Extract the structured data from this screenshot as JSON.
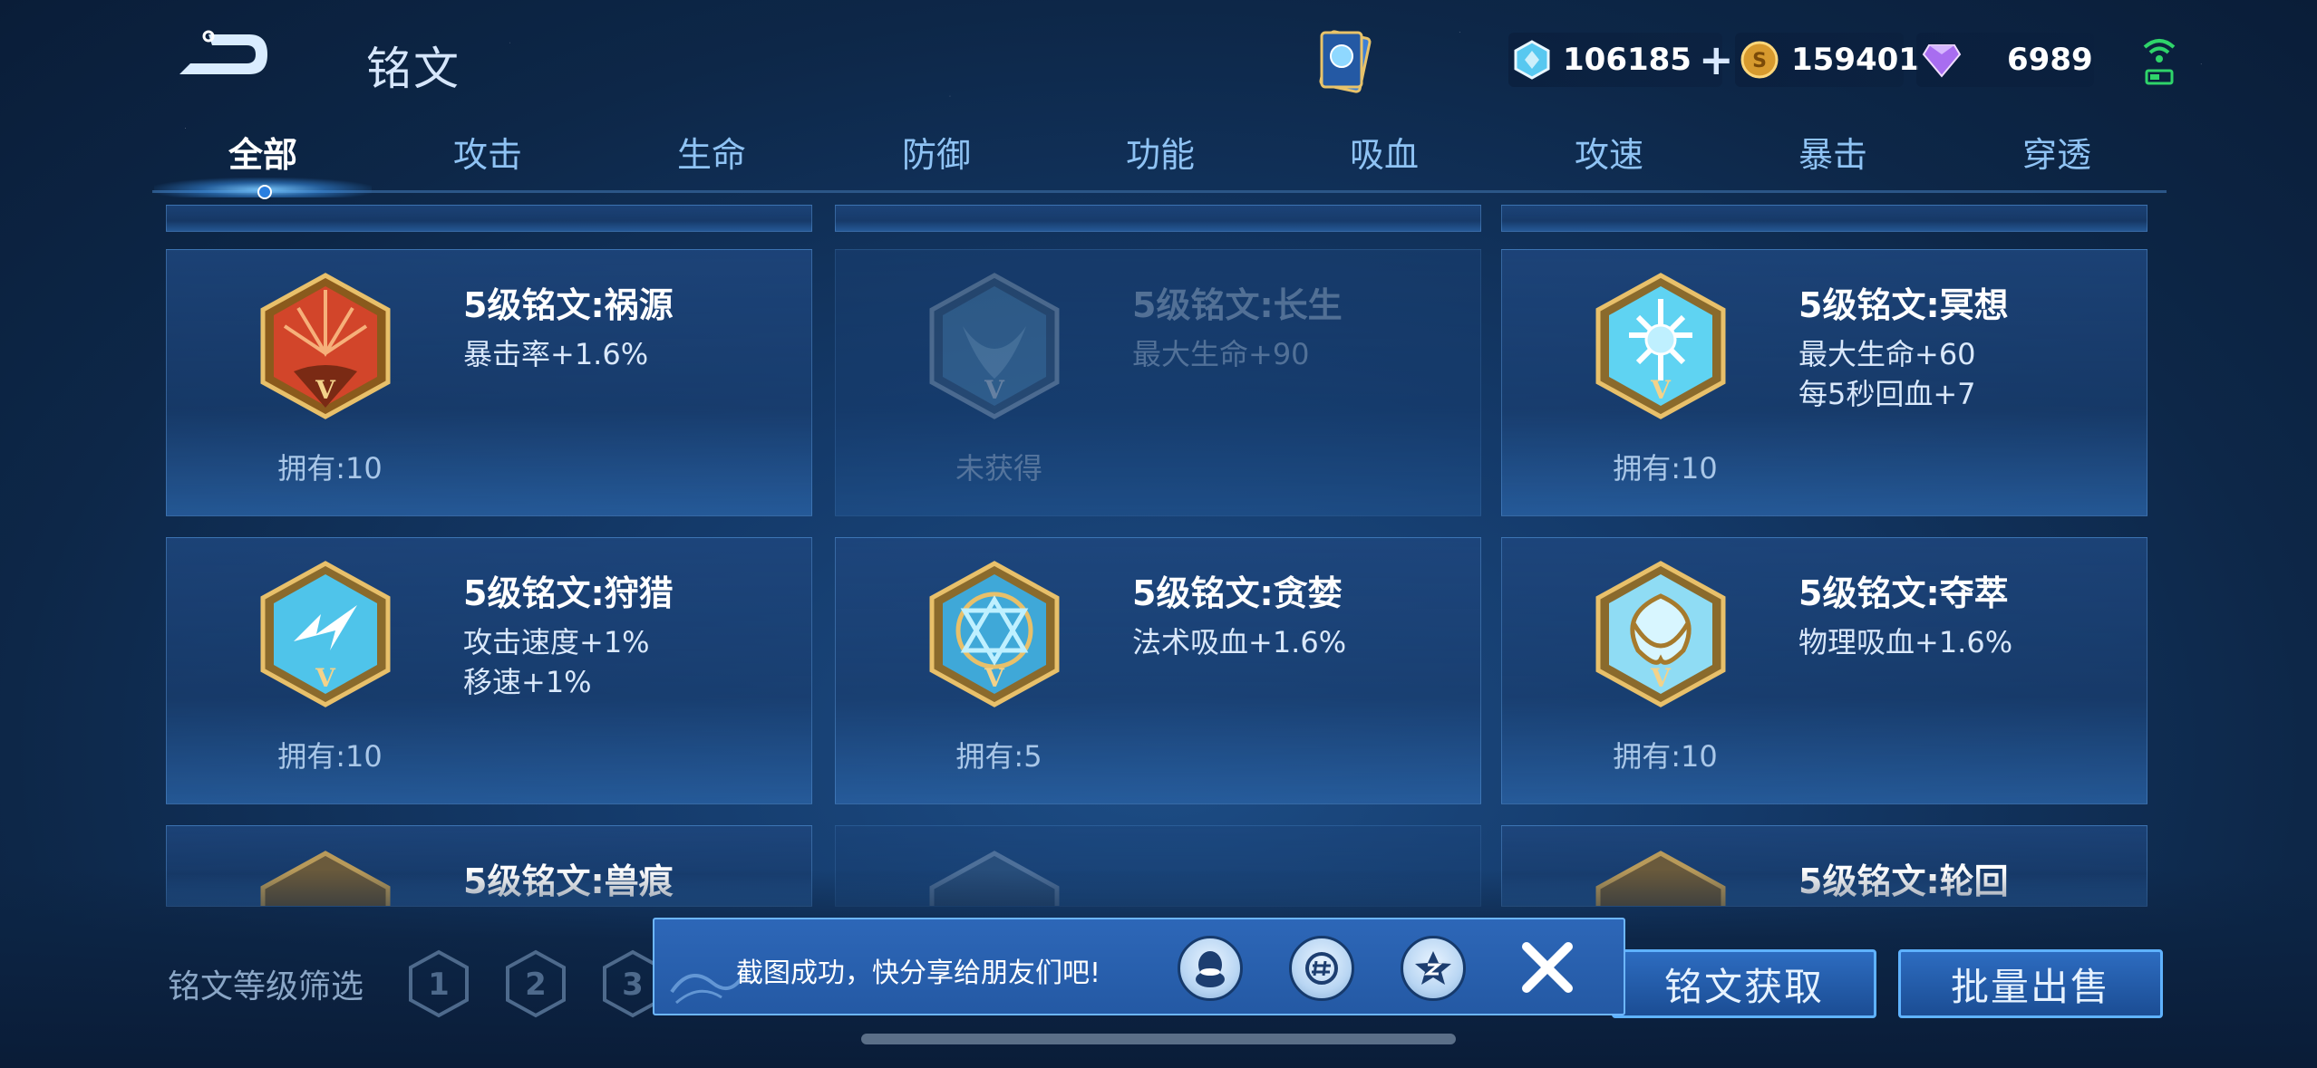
{
  "header": {
    "title": "铭文"
  },
  "currencies": [
    {
      "name": "diamond",
      "icon": "diamond-coupon-icon",
      "value": "106185",
      "has_plus": true
    },
    {
      "name": "gold",
      "icon": "gold-coin-icon",
      "value": "159401",
      "has_plus": false
    },
    {
      "name": "gem",
      "icon": "purple-gem-icon",
      "value": "6989",
      "has_plus": false
    }
  ],
  "tabs": [
    "全部",
    "攻击",
    "生命",
    "防御",
    "功能",
    "吸血",
    "攻速",
    "暴击",
    "穿透"
  ],
  "active_tab": "全部",
  "cards": [
    {
      "title": "5级铭文:祸源",
      "stats": [
        "暴击率+1.6%"
      ],
      "owned": "拥有:10",
      "emblem": "red-crit",
      "obtained": true
    },
    {
      "title": "5级铭文:长生",
      "stats": [
        "最大生命+90"
      ],
      "owned": "未获得",
      "emblem": "blue-life",
      "obtained": false
    },
    {
      "title": "5级铭文:冥想",
      "stats": [
        "最大生命+60",
        "每5秒回血+7"
      ],
      "owned": "拥有:10",
      "emblem": "blue-meditate",
      "obtained": true
    },
    {
      "title": "5级铭文:狩猎",
      "stats": [
        "攻击速度+1%",
        "移速+1%"
      ],
      "owned": "拥有:10",
      "emblem": "blue-hunt",
      "obtained": true
    },
    {
      "title": "5级铭文:贪婪",
      "stats": [
        "法术吸血+1.6%"
      ],
      "owned": "拥有:5",
      "emblem": "blue-greed",
      "obtained": true
    },
    {
      "title": "5级铭文:夺萃",
      "stats": [
        "物理吸血+1.6%"
      ],
      "owned": "拥有:10",
      "emblem": "blue-plunder",
      "obtained": true
    }
  ],
  "partial_cards": [
    {
      "title": "5级铭文:兽痕"
    },
    {
      "title": ""
    },
    {
      "title": "5级铭文:轮回"
    }
  ],
  "filter": {
    "label": "铭文等级筛选",
    "levels": [
      "1",
      "2",
      "3"
    ]
  },
  "actions": {
    "obtain": "铭文获取",
    "bulk_sell": "批量出售"
  },
  "toast": {
    "message": "截图成功，快分享给朋友们吧!",
    "share_targets": [
      "qq-icon",
      "wechat-moments-icon",
      "qzone-icon"
    ]
  },
  "colors": {
    "accent": "#5fb2ff",
    "background": "#143a6a",
    "tab_inactive": "#8fc3f4",
    "gold_frame": "#d4a451",
    "crit_red": "#d2452a",
    "emblem_blue": "#5fd3f2"
  }
}
